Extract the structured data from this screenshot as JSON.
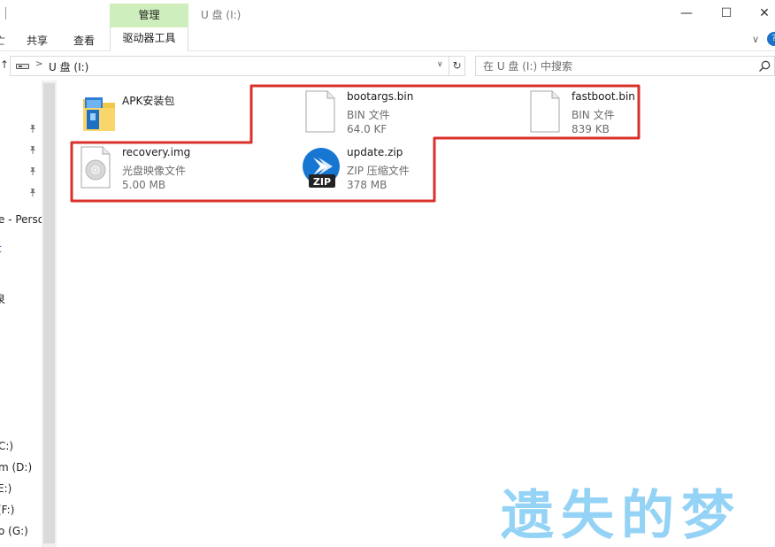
{
  "window": {
    "title": "U 盘 (I:)",
    "context_tab": "管理",
    "minimize_glyph": "—",
    "maximize_glyph": "☐",
    "close_glyph": "✕"
  },
  "ribbon": {
    "cut_glyph": "亡",
    "tabs": [
      {
        "label": "共享"
      },
      {
        "label": "查看"
      },
      {
        "label": "驱动器工具"
      }
    ],
    "expand_glyph": "∨",
    "help_glyph": "?"
  },
  "address": {
    "up_glyph": "↑",
    "separator": ">",
    "path": "U 盘 (I:)",
    "dropdown_glyph": "∨",
    "refresh_glyph": "↻",
    "search_placeholder": "在 U 盘 (I:) 中搜索"
  },
  "nav": {
    "items": [
      {
        "label": "e - Perso"
      },
      {
        "label": "t"
      },
      {
        "label": "泉"
      },
      {
        "label": "C:)"
      },
      {
        "label": "m (D:)"
      },
      {
        "label": "E:)"
      },
      {
        "label": "(F:)"
      },
      {
        "label": "o (G:)"
      }
    ]
  },
  "files": [
    {
      "name": "APK安装包",
      "type": "",
      "size": "",
      "icon": "folder-icon"
    },
    {
      "name": "bootargs.bin",
      "type": "BIN 文件",
      "size": "64.0 KF",
      "icon": "file-icon"
    },
    {
      "name": "fastboot.bin",
      "type": "BIN 文件",
      "size": "839 KB",
      "icon": "file-icon"
    },
    {
      "name": "recovery.img",
      "type": "光盘映像文件",
      "size": "5.00 MB",
      "icon": "disc-image-icon"
    },
    {
      "name": "update.zip",
      "type": "ZIP 压缩文件",
      "size": "378 MB",
      "icon": "zip-archive-icon"
    }
  ],
  "colors": {
    "context_tab_bg": "#cfeebd",
    "highlight_border": "#d9312b",
    "zip_icon_blue": "#1676d2",
    "watermark": "#8fd1f5"
  },
  "watermark": {
    "text": "遗失的梦"
  }
}
